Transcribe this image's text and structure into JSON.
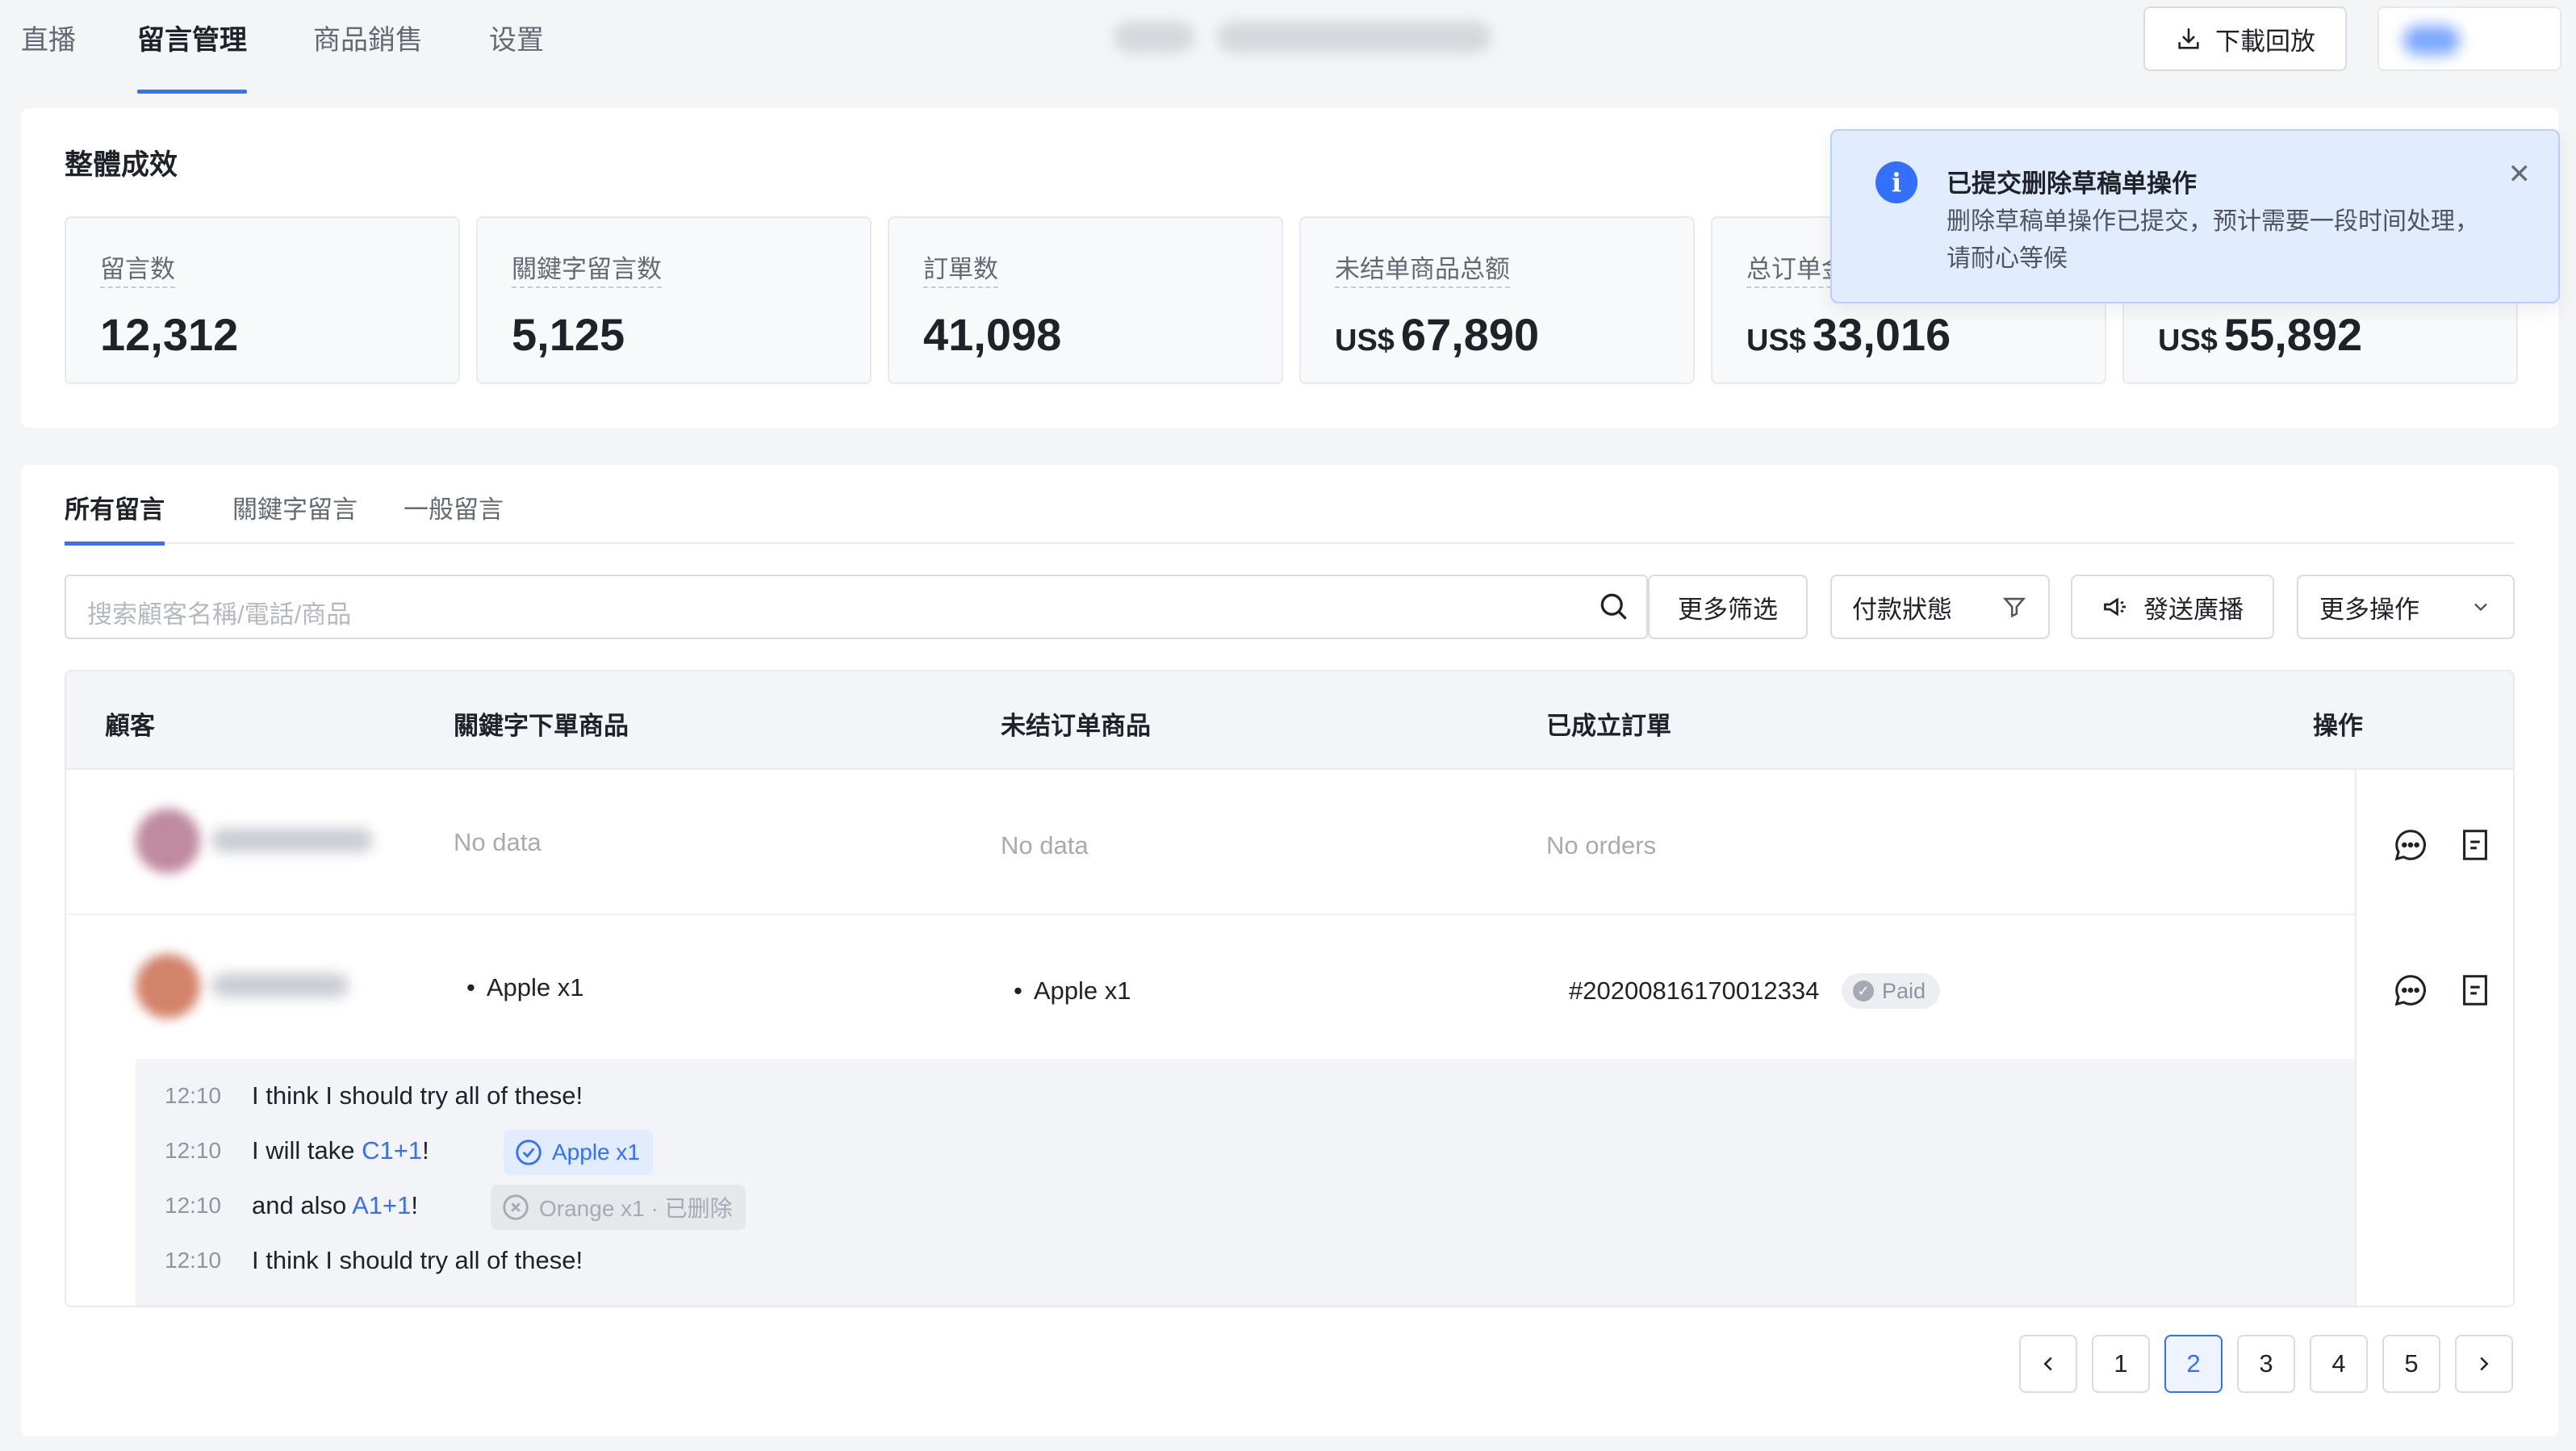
{
  "nav": {
    "tabs": [
      "直播",
      "留言管理",
      "商品銷售",
      "设置"
    ],
    "download_label": "下載回放"
  },
  "summary": {
    "title": "整體成效",
    "stats": [
      {
        "label": "留言数",
        "currency": "",
        "value": "12,312"
      },
      {
        "label": "關鍵字留言数",
        "currency": "",
        "value": "5,125"
      },
      {
        "label": "訂單数",
        "currency": "",
        "value": "41,098"
      },
      {
        "label": "未结单商品总额",
        "currency": "US$",
        "value": "67,890"
      },
      {
        "label": "总订单金额",
        "currency": "US$",
        "value": "33,016"
      },
      {
        "label": "",
        "currency": "US$",
        "value": "55,892"
      }
    ]
  },
  "toast": {
    "title": "已提交删除草稿单操作",
    "message": "删除草稿单操作已提交，预计需要一段时间处理，请耐心等候"
  },
  "comments_panel": {
    "tabs": [
      "所有留言",
      "關鍵字留言",
      "一般留言"
    ],
    "search_placeholder": "搜索顧客名稱/電話/商品",
    "more_filters": "更多筛选",
    "payment_status": "付款狀態",
    "broadcast": "發送廣播",
    "more_actions": "更多操作",
    "columns": [
      "顧客",
      "關鍵字下單商品",
      "未结订单商品",
      "已成立訂單",
      "操作"
    ],
    "rows": [
      {
        "keyword_items": "No data",
        "open_items": "No data",
        "orders": "No orders"
      },
      {
        "keyword_items": "Apple x1",
        "open_items": "Apple x1",
        "order_no": "#20200816170012334",
        "order_status": "Paid"
      }
    ],
    "comments": [
      {
        "time": "12:10",
        "text": "I think I should try all of these!"
      },
      {
        "time": "12:10",
        "text": "I will take ",
        "keyword": "C1+1",
        "suffix": "!",
        "chip": "Apple x1"
      },
      {
        "time": "12:10",
        "text": "and also ",
        "keyword": "A1+1",
        "suffix": "!",
        "chip": "Orange x1 · 已删除"
      },
      {
        "time": "12:10",
        "text": "I think I should try all of these!"
      }
    ]
  },
  "pagination": {
    "pages": [
      "1",
      "2",
      "3",
      "4",
      "5"
    ],
    "current": "2"
  },
  "colors": {
    "accent": "#3370ff",
    "toast_bg": "#e1ecfe"
  }
}
